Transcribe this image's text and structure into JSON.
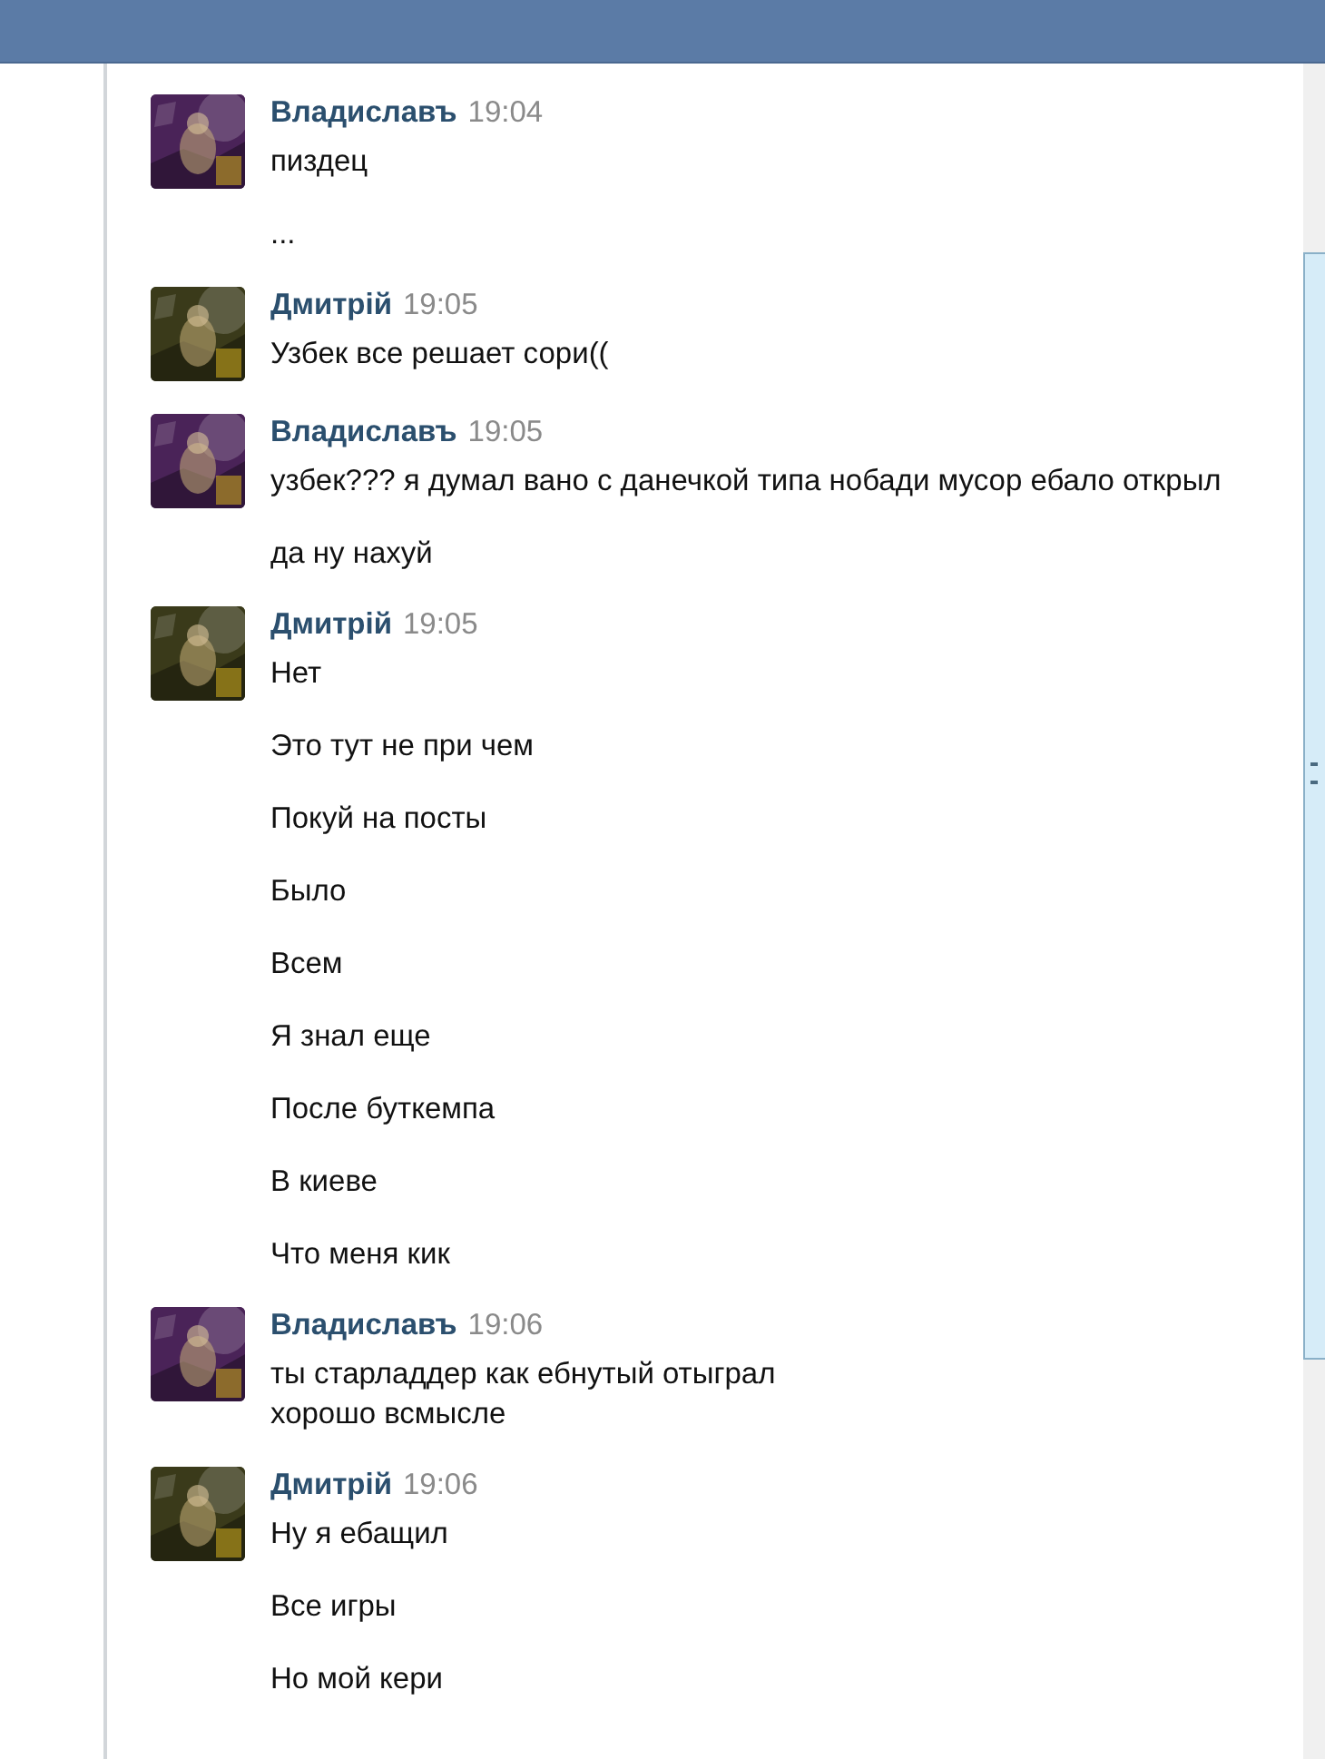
{
  "groups": [
    {
      "author": "Владиславъ",
      "time": "19:04",
      "color": "#4a2358",
      "messages": [
        [
          "пиздец"
        ],
        [
          "..."
        ]
      ]
    },
    {
      "author": "Дмитрій",
      "time": "19:05",
      "color": "#3a3a1a",
      "messages": [
        [
          "Узбек все решает сори(("
        ]
      ]
    },
    {
      "author": "Владиславъ",
      "time": "19:05",
      "color": "#4a2358",
      "messages": [
        [
          "узбек??? я думал вано с данечкой типа нобади мусор ебало открыл"
        ],
        [
          "да ну нахуй"
        ]
      ]
    },
    {
      "author": "Дмитрій",
      "time": "19:05",
      "color": "#3a3a1a",
      "messages": [
        [
          "Нет"
        ],
        [
          "Это тут не при чем"
        ],
        [
          "Покуй на посты"
        ],
        [
          "Было"
        ],
        [
          "Всем"
        ],
        [
          "Я знал еще"
        ],
        [
          "После буткемпа"
        ],
        [
          "В киеве"
        ],
        [
          "Что меня кик"
        ]
      ]
    },
    {
      "author": "Владиславъ",
      "time": "19:06",
      "color": "#4a2358",
      "messages": [
        [
          "ты старладдер как ебнутый отыграл",
          "хорошо всмысле"
        ]
      ]
    },
    {
      "author": "Дмитрій",
      "time": "19:06",
      "color": "#3a3a1a",
      "messages": [
        [
          "Ну я ебащил"
        ],
        [
          "Все игры"
        ],
        [
          "Но мой кери"
        ]
      ]
    }
  ]
}
